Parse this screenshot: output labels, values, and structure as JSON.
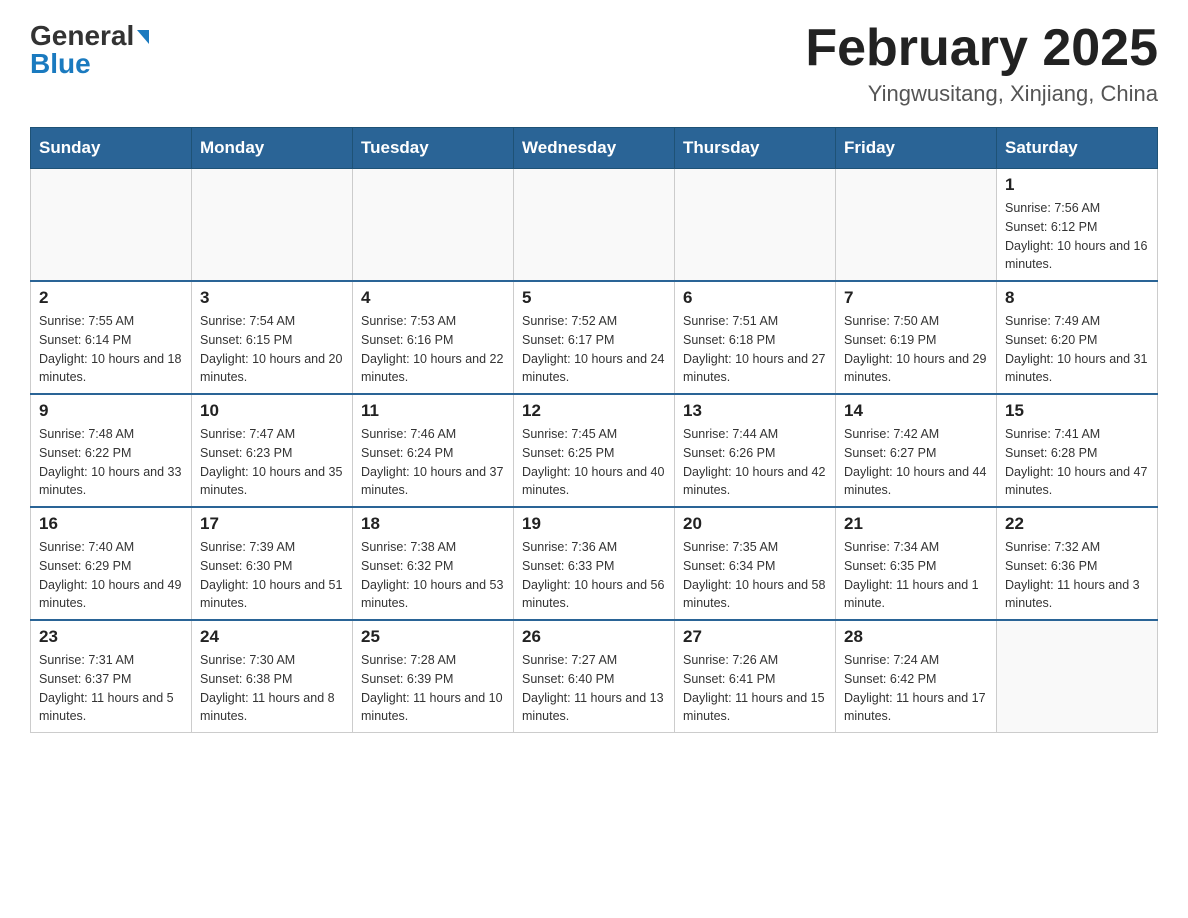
{
  "header": {
    "logo": {
      "part1": "General",
      "part2": "Blue"
    },
    "month": "February 2025",
    "location": "Yingwusitang, Xinjiang, China"
  },
  "days_of_week": [
    "Sunday",
    "Monday",
    "Tuesday",
    "Wednesday",
    "Thursday",
    "Friday",
    "Saturday"
  ],
  "weeks": [
    {
      "days": [
        {
          "date": "",
          "info": ""
        },
        {
          "date": "",
          "info": ""
        },
        {
          "date": "",
          "info": ""
        },
        {
          "date": "",
          "info": ""
        },
        {
          "date": "",
          "info": ""
        },
        {
          "date": "",
          "info": ""
        },
        {
          "date": "1",
          "info": "Sunrise: 7:56 AM\nSunset: 6:12 PM\nDaylight: 10 hours and 16 minutes."
        }
      ]
    },
    {
      "days": [
        {
          "date": "2",
          "info": "Sunrise: 7:55 AM\nSunset: 6:14 PM\nDaylight: 10 hours and 18 minutes."
        },
        {
          "date": "3",
          "info": "Sunrise: 7:54 AM\nSunset: 6:15 PM\nDaylight: 10 hours and 20 minutes."
        },
        {
          "date": "4",
          "info": "Sunrise: 7:53 AM\nSunset: 6:16 PM\nDaylight: 10 hours and 22 minutes."
        },
        {
          "date": "5",
          "info": "Sunrise: 7:52 AM\nSunset: 6:17 PM\nDaylight: 10 hours and 24 minutes."
        },
        {
          "date": "6",
          "info": "Sunrise: 7:51 AM\nSunset: 6:18 PM\nDaylight: 10 hours and 27 minutes."
        },
        {
          "date": "7",
          "info": "Sunrise: 7:50 AM\nSunset: 6:19 PM\nDaylight: 10 hours and 29 minutes."
        },
        {
          "date": "8",
          "info": "Sunrise: 7:49 AM\nSunset: 6:20 PM\nDaylight: 10 hours and 31 minutes."
        }
      ]
    },
    {
      "days": [
        {
          "date": "9",
          "info": "Sunrise: 7:48 AM\nSunset: 6:22 PM\nDaylight: 10 hours and 33 minutes."
        },
        {
          "date": "10",
          "info": "Sunrise: 7:47 AM\nSunset: 6:23 PM\nDaylight: 10 hours and 35 minutes."
        },
        {
          "date": "11",
          "info": "Sunrise: 7:46 AM\nSunset: 6:24 PM\nDaylight: 10 hours and 37 minutes."
        },
        {
          "date": "12",
          "info": "Sunrise: 7:45 AM\nSunset: 6:25 PM\nDaylight: 10 hours and 40 minutes."
        },
        {
          "date": "13",
          "info": "Sunrise: 7:44 AM\nSunset: 6:26 PM\nDaylight: 10 hours and 42 minutes."
        },
        {
          "date": "14",
          "info": "Sunrise: 7:42 AM\nSunset: 6:27 PM\nDaylight: 10 hours and 44 minutes."
        },
        {
          "date": "15",
          "info": "Sunrise: 7:41 AM\nSunset: 6:28 PM\nDaylight: 10 hours and 47 minutes."
        }
      ]
    },
    {
      "days": [
        {
          "date": "16",
          "info": "Sunrise: 7:40 AM\nSunset: 6:29 PM\nDaylight: 10 hours and 49 minutes."
        },
        {
          "date": "17",
          "info": "Sunrise: 7:39 AM\nSunset: 6:30 PM\nDaylight: 10 hours and 51 minutes."
        },
        {
          "date": "18",
          "info": "Sunrise: 7:38 AM\nSunset: 6:32 PM\nDaylight: 10 hours and 53 minutes."
        },
        {
          "date": "19",
          "info": "Sunrise: 7:36 AM\nSunset: 6:33 PM\nDaylight: 10 hours and 56 minutes."
        },
        {
          "date": "20",
          "info": "Sunrise: 7:35 AM\nSunset: 6:34 PM\nDaylight: 10 hours and 58 minutes."
        },
        {
          "date": "21",
          "info": "Sunrise: 7:34 AM\nSunset: 6:35 PM\nDaylight: 11 hours and 1 minute."
        },
        {
          "date": "22",
          "info": "Sunrise: 7:32 AM\nSunset: 6:36 PM\nDaylight: 11 hours and 3 minutes."
        }
      ]
    },
    {
      "days": [
        {
          "date": "23",
          "info": "Sunrise: 7:31 AM\nSunset: 6:37 PM\nDaylight: 11 hours and 5 minutes."
        },
        {
          "date": "24",
          "info": "Sunrise: 7:30 AM\nSunset: 6:38 PM\nDaylight: 11 hours and 8 minutes."
        },
        {
          "date": "25",
          "info": "Sunrise: 7:28 AM\nSunset: 6:39 PM\nDaylight: 11 hours and 10 minutes."
        },
        {
          "date": "26",
          "info": "Sunrise: 7:27 AM\nSunset: 6:40 PM\nDaylight: 11 hours and 13 minutes."
        },
        {
          "date": "27",
          "info": "Sunrise: 7:26 AM\nSunset: 6:41 PM\nDaylight: 11 hours and 15 minutes."
        },
        {
          "date": "28",
          "info": "Sunrise: 7:24 AM\nSunset: 6:42 PM\nDaylight: 11 hours and 17 minutes."
        },
        {
          "date": "",
          "info": ""
        }
      ]
    }
  ]
}
